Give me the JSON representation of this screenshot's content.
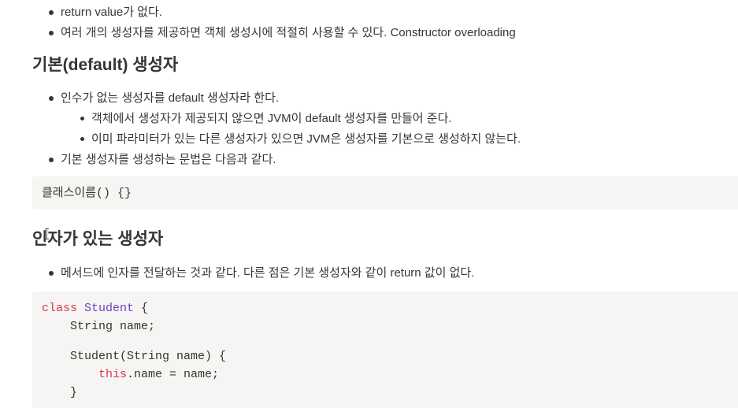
{
  "intro_bullets": [
    "return value가 없다.",
    "여러 개의 생성자를 제공하면 객체 생성시에 적절히 사용할 수 있다. Constructor overloading"
  ],
  "section_default": {
    "heading": "기본(default) 생성자",
    "bullets": [
      "인수가 없는 생성자를 default 생성자라 한다.",
      "객체에서 생성자가 제공되지 않으면 JVM이 default 생성자를 만들어 준다.",
      "이미 파라미터가 있는 다른 생성자가 있으면 JVM은 생성자를 기본으로 생성하지 않는다.",
      "기본 생성자를 생성하는 문법은 다음과 같다."
    ],
    "code": {
      "prefix": "클래스이름",
      "suffix": "() {}"
    }
  },
  "section_args": {
    "heading": "인자가 있는 생성자",
    "bullets": [
      "메서드에 인자를 전달하는 것과 같다. 다른 점은 기본 생성자와 같이 return 값이 없다."
    ],
    "code": {
      "line1_kw": "class",
      "line1_cls": "Student",
      "line1_rest": " {",
      "line2": "    String name;",
      "line3": "    Student(String name) {",
      "line4_indent": "        ",
      "line4_kw": "this",
      "line4_rest": ".name = name;",
      "line5": "    }"
    }
  }
}
